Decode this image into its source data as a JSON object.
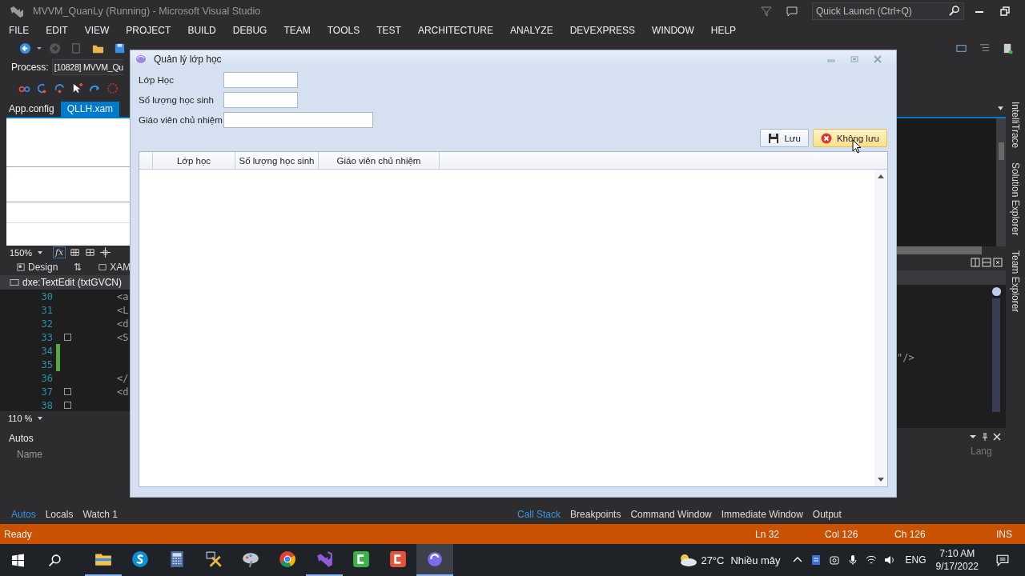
{
  "ide": {
    "title": "MVVM_QuanLy (Running) - Microsoft Visual Studio",
    "quick_launch": {
      "placeholder": "Quick Launch (Ctrl+Q)"
    },
    "menu": [
      "FILE",
      "EDIT",
      "VIEW",
      "PROJECT",
      "BUILD",
      "DEBUG",
      "TEAM",
      "TOOLS",
      "TEST",
      "ARCHITECTURE",
      "ANALYZE",
      "DEVEXPRESS",
      "WINDOW",
      "HELP"
    ],
    "process": {
      "label": "Process:",
      "value": "[10828] MVVM_Qu"
    },
    "doc_tabs": [
      {
        "label": "App.config",
        "selected": false
      },
      {
        "label": "QLLH.xam",
        "selected": true
      }
    ],
    "designer_zoom": "150%",
    "formula_button": "fx",
    "view_tabs": [
      {
        "label": "Design",
        "kind": "design"
      },
      {
        "label": "⇅",
        "kind": "swap"
      },
      {
        "label": "XAM",
        "kind": "xaml"
      }
    ],
    "breadcrumb": "dxe:TextEdit (txtGVCN)",
    "code_lines": [
      {
        "number": "30",
        "text": "<a",
        "changed": false,
        "foldable": false
      },
      {
        "number": "31",
        "text": "<L",
        "changed": false,
        "foldable": false
      },
      {
        "number": "32",
        "text": "<d",
        "changed": false,
        "foldable": false
      },
      {
        "number": "33",
        "text": "<S",
        "changed": false,
        "foldable": true
      },
      {
        "number": "34",
        "changed": true,
        "foldable": false
      },
      {
        "number": "35",
        "changed": true,
        "foldable": false
      },
      {
        "number": "36",
        "text": "</",
        "changed": false,
        "foldable": false
      },
      {
        "number": "37",
        "text": "<d",
        "changed": false,
        "foldable": true
      },
      {
        "number": "38",
        "changed": false,
        "foldable": true
      }
    ],
    "code_right_fragment": "\"/>",
    "code_zoom": "110 %",
    "side_tabs": [
      "IntelliTrace",
      "Solution Explorer",
      "Team Explorer"
    ],
    "autos": {
      "title": "Autos",
      "name_column": "Name",
      "lang_column": "Lang"
    },
    "debug_tabs_left": [
      {
        "label": "Autos",
        "selected": true
      },
      {
        "label": "Locals",
        "selected": false
      },
      {
        "label": "Watch 1",
        "selected": false
      }
    ],
    "debug_tabs_right": [
      {
        "label": "Call Stack",
        "selected": true
      },
      {
        "label": "Breakpoints",
        "selected": false
      },
      {
        "label": "Command Window",
        "selected": false
      },
      {
        "label": "Immediate Window",
        "selected": false
      },
      {
        "label": "Output",
        "selected": false
      }
    ],
    "status": {
      "text": "Ready",
      "ln": "Ln 32",
      "col": "Col 126",
      "ch": "Ch 126",
      "mode": "INS"
    }
  },
  "dialog": {
    "title": "Quản lý lớp học",
    "fields": [
      {
        "label": "Lớp Học",
        "wide": false
      },
      {
        "label": "Số lượng học sinh",
        "wide": false
      },
      {
        "label": "Giáo viên chủ nhiệm",
        "wide": true
      }
    ],
    "buttons": [
      {
        "label": "Lưu",
        "kind": "save",
        "hover": false
      },
      {
        "label": "Không lưu",
        "kind": "cancel",
        "hover": true
      }
    ],
    "grid": {
      "columns": [
        "Lớp học",
        "Số lượng học sinh",
        "Giáo viên chủ nhiệm"
      ]
    }
  },
  "taskbar": {
    "apps": [
      {
        "kind": "folder",
        "running": true,
        "selected": false
      },
      {
        "kind": "skype",
        "running": false,
        "selected": false
      },
      {
        "kind": "calculator",
        "running": false,
        "selected": false
      },
      {
        "kind": "tools",
        "running": false,
        "selected": false
      },
      {
        "kind": "paint",
        "running": false,
        "selected": false
      },
      {
        "kind": "chrome",
        "running": false,
        "selected": false
      },
      {
        "kind": "vs",
        "running": true,
        "selected": false
      },
      {
        "kind": "green",
        "running": false,
        "selected": false
      },
      {
        "kind": "red",
        "running": false,
        "selected": false
      },
      {
        "kind": "app",
        "running": true,
        "selected": true
      }
    ],
    "weather": {
      "temp": "27°C",
      "text": "Nhiều mây"
    },
    "language": "ENG",
    "time": "7:10 AM",
    "date": "9/17/2022"
  }
}
